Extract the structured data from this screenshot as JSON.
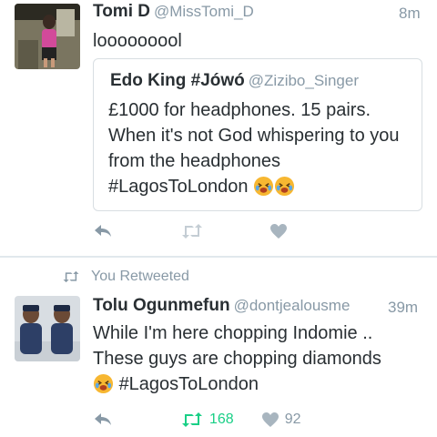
{
  "tweet1": {
    "name": "Tomi D",
    "handle": "@MissTomi_D",
    "time": "8m",
    "text": "looooooool",
    "quoted": {
      "name": "Edo King #Jówó",
      "handle": "@Zizibo_Singer",
      "text": "£1000 for headphones. 15 pairs. When it's not God whispering to you from the headphones #LagosToLondon"
    },
    "icons": [
      "reply-icon",
      "retweet-icon",
      "heart-icon"
    ]
  },
  "tweet2": {
    "retweet_banner": "You Retweeted",
    "name": "Tolu Ogunmefun",
    "handle": "@dontjealousme",
    "time": "39m",
    "text_line1": "While I'm here chopping Indomie ..",
    "text_line2": "These guys are chopping diamonds",
    "text_line3": "#LagosToLondon",
    "retweet_count": "168",
    "like_count": "92",
    "colors": {
      "retweeted": "#19cf86",
      "muted": "#8899a6",
      "link_border": "#d8dee2"
    }
  }
}
